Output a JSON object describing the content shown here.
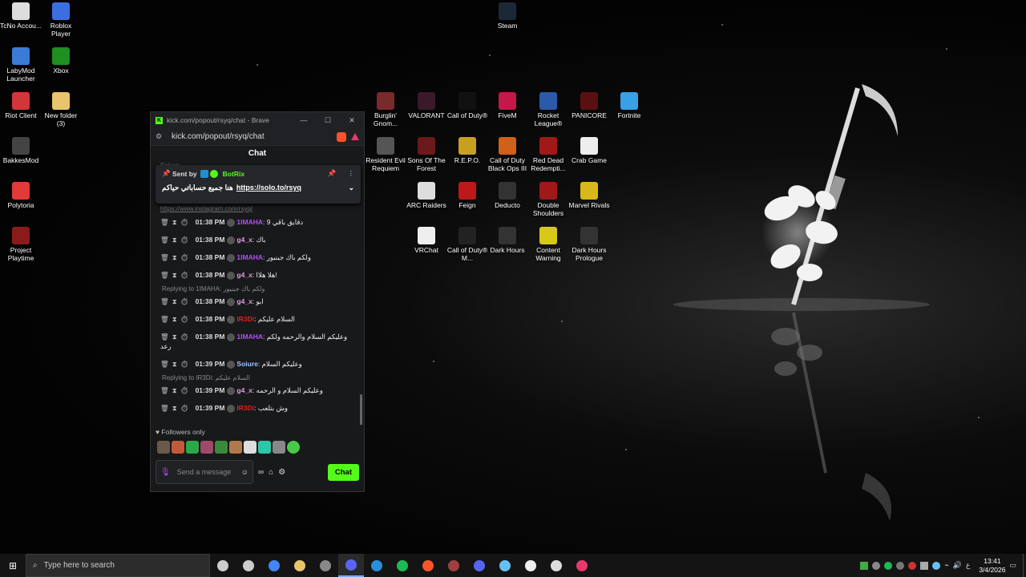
{
  "desktop_icons": [
    {
      "label": "TcNo Accou...",
      "icon": "tcno-icon",
      "color": "#ddd"
    },
    {
      "label": "Roblox Player",
      "icon": "roblox-icon",
      "color": "#3b6fe0"
    },
    {
      "label": "LabyMod Launcher",
      "icon": "labymod-icon",
      "color": "#3a7bd5"
    },
    {
      "label": "Xbox",
      "icon": "xbox-icon",
      "color": "#1f8f1f"
    },
    {
      "label": "Riot Client",
      "icon": "riot-icon",
      "color": "#d13639"
    },
    {
      "label": "New folder (3)",
      "icon": "folder-icon",
      "color": "#e8c46b"
    },
    {
      "label": "BakkesMod",
      "icon": "bakkesmod-icon",
      "color": "#444"
    },
    {
      "label": "Polytoria",
      "icon": "polytoria-icon",
      "color": "#e03a3a"
    },
    {
      "label": "Project Playtime",
      "icon": "project-playtime-icon",
      "color": "#8b1a1a"
    },
    {
      "label": "Steam",
      "icon": "steam-icon",
      "color": "#1b2838"
    },
    {
      "label": "Burglin' Gnom...",
      "icon": "burglin-gnomes-icon",
      "color": "#7a2a2a"
    },
    {
      "label": "VALORANT",
      "icon": "valorant-icon",
      "color": "#3a1a2a"
    },
    {
      "label": "Call of Duty®",
      "icon": "cod-icon",
      "color": "#111"
    },
    {
      "label": "FiveM",
      "icon": "fivem-icon",
      "color": "#c4184a"
    },
    {
      "label": "Rocket League®",
      "icon": "rocket-league-icon",
      "color": "#2a5aa8"
    },
    {
      "label": "PANICORE",
      "icon": "panicore-icon",
      "color": "#5a1010"
    },
    {
      "label": "Fortnite",
      "icon": "fortnite-icon",
      "color": "#36a0e8"
    },
    {
      "label": "Resident Evil Requiem",
      "icon": "resident-evil-icon",
      "color": "#555"
    },
    {
      "label": "Sons Of The Forest",
      "icon": "sons-forest-icon",
      "color": "#6a1a1a"
    },
    {
      "label": "R.E.P.O.",
      "icon": "repo-icon",
      "color": "#c8a020"
    },
    {
      "label": "Call of Duty Black Ops III",
      "icon": "bo3-icon",
      "color": "#d0601a"
    },
    {
      "label": "Red Dead Redempti...",
      "icon": "rdr-icon",
      "color": "#a01818"
    },
    {
      "label": "Crab Game",
      "icon": "crab-game-icon",
      "color": "#eee"
    },
    {
      "label": "ARC Raiders",
      "icon": "arc-raiders-icon",
      "color": "#ddd"
    },
    {
      "label": "Feign",
      "icon": "feign-icon",
      "color": "#c01818"
    },
    {
      "label": "Deducto",
      "icon": "deducto-icon",
      "color": "#333"
    },
    {
      "label": "Double Shoulders",
      "icon": "double-shoulders-icon",
      "color": "#a01818"
    },
    {
      "label": "Marvel Rivals",
      "icon": "marvel-rivals-icon",
      "color": "#d8b818"
    },
    {
      "label": "VRChat",
      "icon": "vrchat-icon",
      "color": "#eee"
    },
    {
      "label": "Call of Duty® M...",
      "icon": "cod-mw-icon",
      "color": "#222"
    },
    {
      "label": "Dark Hours",
      "icon": "dark-hours-icon",
      "color": "#333"
    },
    {
      "label": "Content Warning",
      "icon": "content-warning-icon",
      "color": "#d8c818"
    },
    {
      "label": "Dark Hours Prologue",
      "icon": "dark-hours-prologue-icon",
      "color": "#333"
    }
  ],
  "browser": {
    "title": "kick.com/popout/rsyq/chat - Brave",
    "url": "kick.com/popout/rsyq/chat"
  },
  "chat": {
    "header": "Chat",
    "old_line_top": "Soiure: ...",
    "old_line_bottom": "https://www.instagram.com/rsyq/",
    "pinned": {
      "sent_by": "Sent by",
      "bot_name": "BotRix",
      "text": "هنا جميع حساباتي حياكم",
      "link": "https://solo.to/rsyq"
    },
    "messages": [
      {
        "time": "01:38 PM",
        "user": "1IMAHA",
        "color": "#b44dff",
        "text": "دقايق باقي 9",
        "reply": ""
      },
      {
        "time": "01:38 PM",
        "user": "g4_x",
        "color": "#e89adf",
        "text": "باك",
        "reply": ""
      },
      {
        "time": "01:38 PM",
        "user": "1IMAHA",
        "color": "#b44dff",
        "text": "ولكم باك جينيور",
        "reply": ""
      },
      {
        "time": "01:38 PM",
        "user": "g4_x",
        "color": "#e89adf",
        "text": "هلا هلاا!",
        "reply": ""
      },
      {
        "time": "01:38 PM",
        "user": "g4_x",
        "color": "#e89adf",
        "text": "ابو",
        "reply": "Replying to 1IMAHA: ولكم باك جينيور"
      },
      {
        "time": "01:38 PM",
        "user": "IR3Di",
        "color": "#e02020",
        "text": "السلام عليكم",
        "reply": ""
      },
      {
        "time": "01:38 PM",
        "user": "1IMAHA",
        "color": "#b44dff",
        "text": "وعليكم السلام والرحمه ولكم رعد",
        "reply": ""
      },
      {
        "time": "01:39 PM",
        "user": "Soiure",
        "color": "#9ec7ff",
        "text": "وعليكم السلام",
        "reply": ""
      },
      {
        "time": "01:39 PM",
        "user": "g4_x",
        "color": "#e89adf",
        "text": "وعليكم السلام و الرحمه",
        "reply": "Replying to IR3Di: السلام عليكم"
      },
      {
        "time": "01:39 PM",
        "user": "IR3Di",
        "color": "#e02020",
        "text": "وش بتلعب",
        "reply": ""
      }
    ],
    "followers_only": "Followers only",
    "input_placeholder": "Send a message",
    "chat_button": "Chat"
  },
  "taskbar": {
    "search_placeholder": "Type here to search",
    "apps": [
      {
        "name": "task-view-icon",
        "color": "#ccc"
      },
      {
        "name": "settings-gear-icon",
        "color": "#ccc"
      },
      {
        "name": "chrome-icon",
        "color": "#4285f4"
      },
      {
        "name": "file-explorer-icon",
        "color": "#e8c46b"
      },
      {
        "name": "obs-icon",
        "color": "#888"
      },
      {
        "name": "discord-badge-icon",
        "color": "#5865f2"
      },
      {
        "name": "app-blue-icon",
        "color": "#2a8fd8"
      },
      {
        "name": "spotify-icon",
        "color": "#1db954"
      },
      {
        "name": "brave-icon",
        "color": "#fb542b"
      },
      {
        "name": "game-icon",
        "color": "#a04040"
      },
      {
        "name": "discord-icon",
        "color": "#5865f2"
      },
      {
        "name": "steam-taskbar-icon",
        "color": "#66c0f4"
      },
      {
        "name": "g-icon",
        "color": "#eee"
      },
      {
        "name": "app-round-icon",
        "color": "#ddd"
      },
      {
        "name": "app-red-icon",
        "color": "#e8396a"
      }
    ],
    "clock_time": "13:41",
    "clock_date": "3/4/2026",
    "lang": "ع"
  }
}
